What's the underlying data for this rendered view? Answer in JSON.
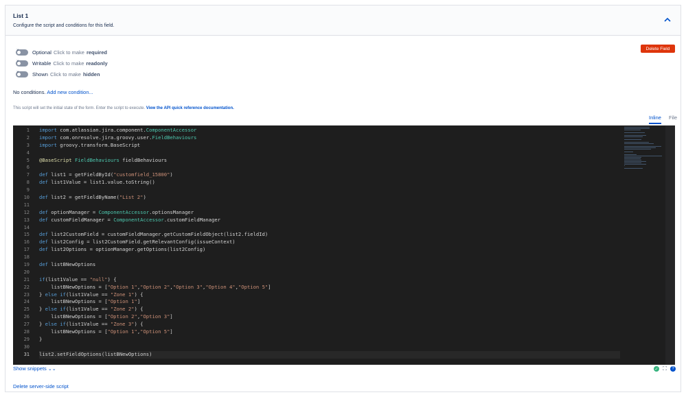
{
  "header": {
    "title": "List 1",
    "subtitle": "Configure the script and conditions for this field."
  },
  "toggles": [
    {
      "label": "Optional",
      "hint": "Click to make",
      "action": "required"
    },
    {
      "label": "Writable",
      "hint": "Click to make",
      "action": "readonly"
    },
    {
      "label": "Shown",
      "hint": "Click to make",
      "action": "hidden"
    }
  ],
  "delete_field_label": "Delete Field",
  "conditions": {
    "text": "No conditions.",
    "link": "Add new condition..."
  },
  "note": {
    "text": "This script will set the initial state of the form. Enter the script to execute.",
    "link": "View the API quick reference documentation."
  },
  "tabs": [
    "Inline",
    "File"
  ],
  "code_lines": [
    "import com.atlassian.jira.component.ComponentAccessor",
    "import com.onresolve.jira.groovy.user.FieldBehaviours",
    "import groovy.transform.BaseScript",
    "",
    "@BaseScript FieldBehaviours fieldBehaviours",
    "",
    "def list1 = getFieldById(\"customfield_15800\")",
    "def list1Value = list1.value.toString()",
    "",
    "def list2 = getFieldByName(\"List 2\")",
    "",
    "def optionManager = ComponentAccessor.optionsManager",
    "def customFieldManager = ComponentAccessor.customFieldManager",
    "",
    "def list2CustomField = customFieldManager.getCustomFieldObject(list2.fieldId)",
    "def list2Config = list2CustomField.getRelevantConfig(issueContext)",
    "def list2Options = optionManager.getOptions(list2Config)",
    "",
    "def listBNewOptions",
    "",
    "if(list1Value == \"null\") {",
    "    listBNewOptions = [\"Option 1\",\"Option 2\",\"Option 3\",\"Option 4\",\"Option 5\"]",
    "} else if(list1Value == \"Zone 1\") {",
    "    listBNewOptions = [\"Option 1\"]",
    "} else if(list1Value == \"Zone 2\") {",
    "    listBNewOptions = [\"Option 2\",\"Option 3\"]",
    "} else if(list1Value == \"Zone 3\") {",
    "    listBNewOptions = [\"Option 1\",\"Option 5\"]",
    "}",
    "",
    "list2.setFieldOptions(listBNewOptions)"
  ],
  "current_line": 31,
  "show_snippets_label": "Show snippets",
  "delete_server_script_label": "Delete server-side script",
  "colors": {
    "accent": "#0052cc",
    "danger": "#de350b",
    "editor_bg": "#1e1e1e"
  }
}
